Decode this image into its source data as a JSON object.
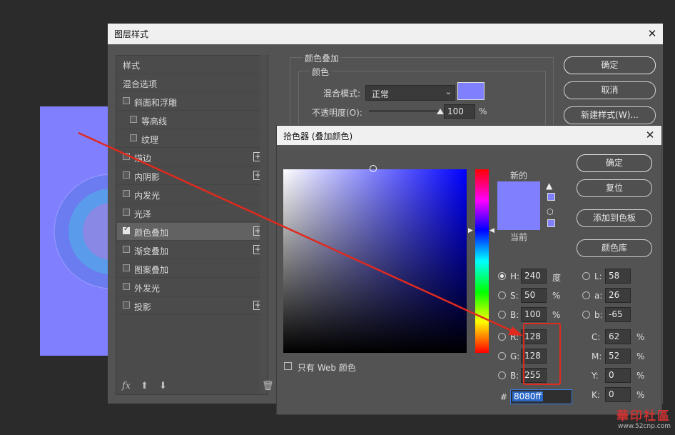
{
  "colors": {
    "overlay_color": "#8080ff",
    "current_color": "#8080ff",
    "new_color": "#8080ff",
    "annotation": "#e02a1e"
  },
  "layer_style": {
    "title": "图层样式",
    "list": [
      {
        "label": "样式",
        "checkbox": false,
        "checked": false,
        "plus": false,
        "indent": 0
      },
      {
        "label": "混合选项",
        "checkbox": false,
        "checked": false,
        "plus": false,
        "indent": 0
      },
      {
        "label": "斜面和浮雕",
        "checkbox": true,
        "checked": false,
        "plus": false,
        "indent": 0
      },
      {
        "label": "等高线",
        "checkbox": true,
        "checked": false,
        "plus": false,
        "indent": 1
      },
      {
        "label": "纹理",
        "checkbox": true,
        "checked": false,
        "plus": false,
        "indent": 1
      },
      {
        "label": "描边",
        "checkbox": true,
        "checked": false,
        "plus": true,
        "indent": 0
      },
      {
        "label": "内阴影",
        "checkbox": true,
        "checked": false,
        "plus": true,
        "indent": 0
      },
      {
        "label": "内发光",
        "checkbox": true,
        "checked": false,
        "plus": false,
        "indent": 0
      },
      {
        "label": "光泽",
        "checkbox": true,
        "checked": false,
        "plus": false,
        "indent": 0
      },
      {
        "label": "颜色叠加",
        "checkbox": true,
        "checked": true,
        "plus": true,
        "indent": 0,
        "selected": true
      },
      {
        "label": "渐变叠加",
        "checkbox": true,
        "checked": false,
        "plus": true,
        "indent": 0
      },
      {
        "label": "图案叠加",
        "checkbox": true,
        "checked": false,
        "plus": false,
        "indent": 0
      },
      {
        "label": "外发光",
        "checkbox": true,
        "checked": false,
        "plus": false,
        "indent": 0
      },
      {
        "label": "投影",
        "checkbox": true,
        "checked": false,
        "plus": true,
        "indent": 0
      }
    ],
    "footer": {
      "fx": "fx"
    },
    "panel": {
      "group_title": "颜色叠加",
      "sub_title": "颜色",
      "blend_mode_label": "混合模式:",
      "blend_mode_value": "正常",
      "opacity_label": "不透明度(O):",
      "opacity_value": "100",
      "opacity_unit": "%",
      "opacity_fraction": 1.0
    },
    "buttons": {
      "ok": "确定",
      "cancel": "取消",
      "new_style": "新建样式(W)..."
    }
  },
  "color_picker": {
    "title": "拾色器 (叠加颜色)",
    "new_label": "新的",
    "current_label": "当前",
    "buttons": {
      "ok": "确定",
      "reset": "复位",
      "add_swatch": "添加到色板",
      "libraries": "颜色库"
    },
    "web_only_label": "只有 Web 颜色",
    "hsb": [
      {
        "key": "H:",
        "value": "240",
        "unit": "度",
        "selected": true
      },
      {
        "key": "S:",
        "value": "50",
        "unit": "%",
        "selected": false
      },
      {
        "key": "B:",
        "value": "100",
        "unit": "%",
        "selected": false
      }
    ],
    "rgb": [
      {
        "key": "R:",
        "value": "128"
      },
      {
        "key": "G:",
        "value": "128"
      },
      {
        "key": "B:",
        "value": "255"
      }
    ],
    "lab": [
      {
        "key": "L:",
        "value": "58"
      },
      {
        "key": "a:",
        "value": "26"
      },
      {
        "key": "b:",
        "value": "-65"
      }
    ],
    "cmyk": [
      {
        "key": "C:",
        "value": "62",
        "unit": "%"
      },
      {
        "key": "M:",
        "value": "52",
        "unit": "%"
      },
      {
        "key": "Y:",
        "value": "0",
        "unit": "%"
      },
      {
        "key": "K:",
        "value": "0",
        "unit": "%"
      }
    ],
    "hex_label": "#",
    "hex_value": "8080ff",
    "icons": {
      "warning": "warning-triangle-icon",
      "cube": "web-safe-cube-icon"
    }
  },
  "watermark": {
    "text": "華印社區",
    "url": "www.52cnp.com"
  }
}
